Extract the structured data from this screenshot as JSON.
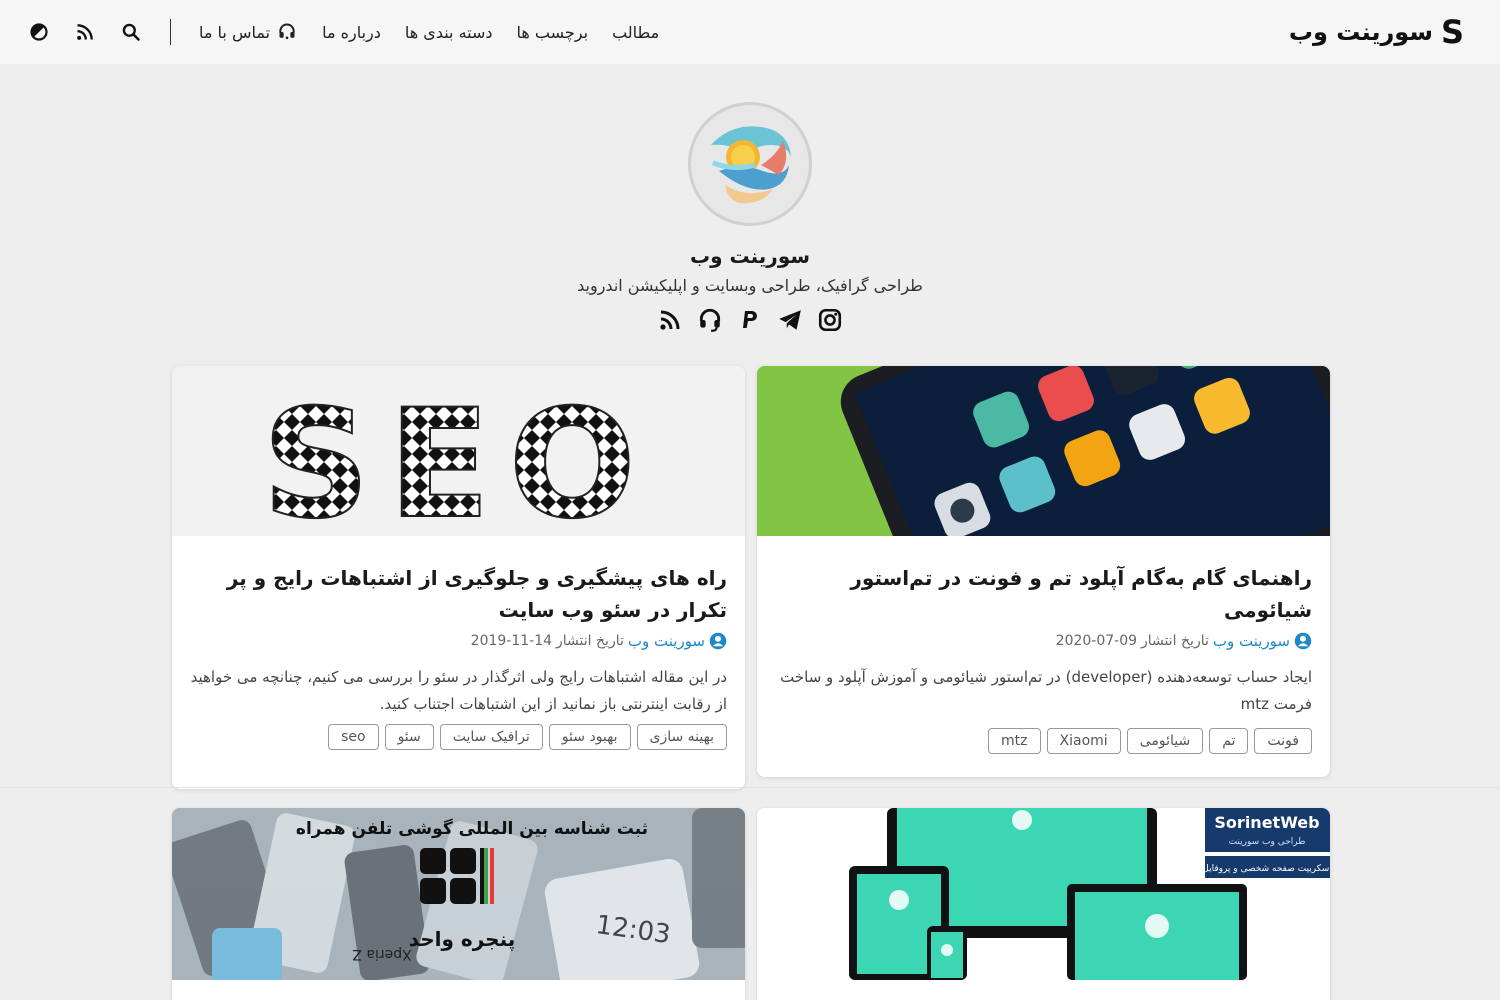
{
  "header": {
    "logo_mark": "S",
    "site_title": "سورینت وب",
    "menu": [
      "مطالب",
      "برچسب ها",
      "دسته بندی ها",
      "درباره ما",
      "تماس با ما"
    ],
    "icons": [
      "search-icon",
      "rss-icon",
      "theme-toggle-icon"
    ]
  },
  "profile": {
    "name": "سورینت وب",
    "bio": "طراحی گرافیک، طراحی وبسایت و اپلیکیشن اندروید",
    "social_icons": [
      "instagram-icon",
      "telegram-icon",
      "paypal-icon",
      "support-icon",
      "rss-icon"
    ]
  },
  "posts": [
    {
      "title": "راهنمای گام به‌گام آپلود تم و فونت در تم‌استور شیائومی",
      "author": "سورینت وب",
      "date_label": "تاریخ انتشار",
      "date": "2020-07-09",
      "excerpt": "ایجاد حساب توسعه‌دهنده (developer) در تم‌استور شیائومی و آموزش آپلود و ساخت فرمت mtz",
      "tags": [
        "فونت",
        "تم",
        "شیائومی",
        "Xiaomi",
        "mtz"
      ]
    },
    {
      "title": "راه های پیشگیری و جلوگیری از اشتباهات رایج و پر تکرار در سئو وب سایت",
      "author": "سورینت وب",
      "date_label": "تاریخ انتشار",
      "date": "2019-11-14",
      "excerpt": "در این مقاله اشتباهات رایج ولی اثرگذار در سئو را بررسی می کنیم، چنانچه می خواهید از رقابت اینترنتی باز نمانید از این اشتباهات اجتناب کنید.",
      "tags": [
        "بهینه سازی",
        "بهبود سئو",
        "ترافیک سایت",
        "سئو",
        "seo"
      ],
      "image_text": "SEO"
    }
  ],
  "bottom_cards": [
    {
      "brand": "SorinetWeb",
      "brand_sub": "طراحی وب سورینت",
      "caption": "اسکریپت صفحه شخصی و پروفایل"
    },
    {
      "heading": "ثبت شناسه بین المللی گوشی تلفن همراه",
      "logo_text": "پنجره واحد",
      "screen_time": "12:03",
      "phone_label": "Xperia Z"
    }
  ],
  "colors": {
    "accent": "#1e88c7",
    "background": "#eeeeee",
    "header": "#f6f6f6",
    "tag_border": "#999999"
  }
}
